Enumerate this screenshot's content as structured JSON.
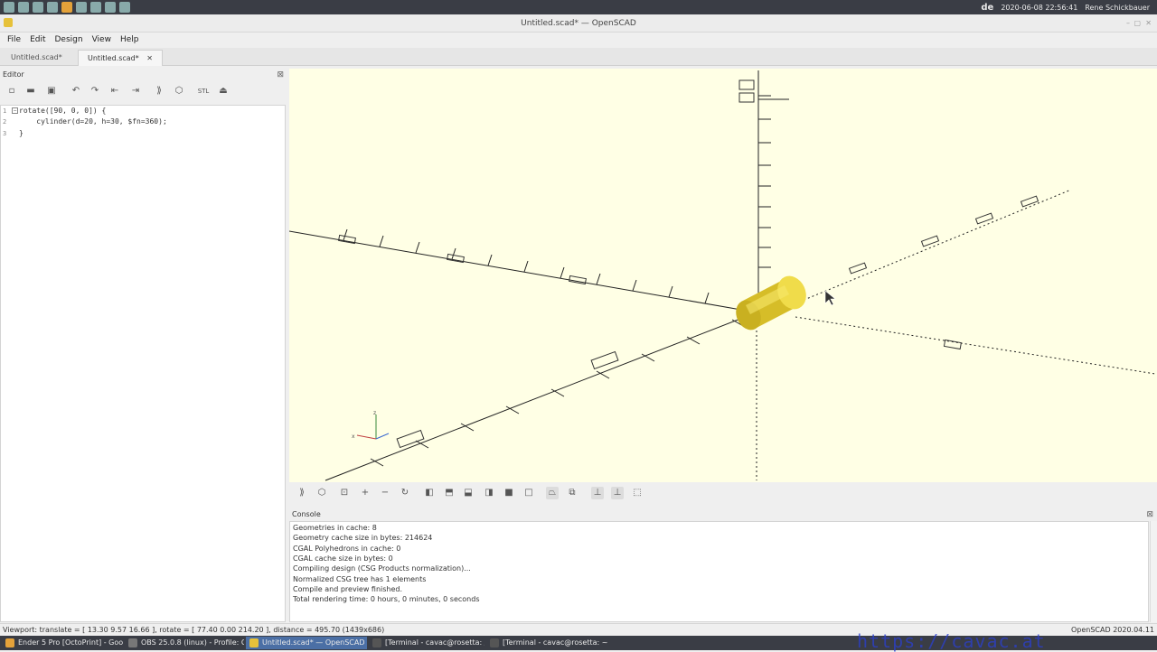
{
  "system_tray": {
    "language": "de",
    "clock": "2020-06-08 22:56:41",
    "user": "Rene Schickbauer"
  },
  "window": {
    "title": "Untitled.scad* — OpenSCAD"
  },
  "menu": {
    "items": [
      "File",
      "Edit",
      "Design",
      "View",
      "Help"
    ]
  },
  "tabs": [
    {
      "label": "Untitled.scad*",
      "active": false
    },
    {
      "label": "Untitled.scad*",
      "active": true,
      "close": "✕"
    }
  ],
  "editor": {
    "title": "Editor",
    "lines": [
      {
        "num": "1",
        "text": "rotate([90, 0, 0]) {"
      },
      {
        "num": "2",
        "text": "    cylinder(d=20, h=30, $fn=360);"
      },
      {
        "num": "3",
        "text": "}"
      }
    ]
  },
  "viewport": {
    "background": "#ffffe5",
    "object_color": "#e6cf3a",
    "axis_color": "#222222"
  },
  "console": {
    "title": "Console",
    "lines": [
      "Geometries in cache: 8",
      "Geometry cache size in bytes: 214624",
      "CGAL Polyhedrons in cache: 0",
      "CGAL cache size in bytes: 0",
      "Compiling design (CSG Products normalization)...",
      "Normalized CSG tree has 1 elements",
      "Compile and preview finished.",
      "Total rendering time: 0 hours, 0 minutes, 0 seconds"
    ]
  },
  "status": {
    "viewport_info": "Viewport: translate = [ 13.30 9.57 16.66 ], rotate = [ 77.40 0.00 214.20 ], distance = 495.70 (1439x686)",
    "version": "OpenSCAD 2020.04.11"
  },
  "taskbar": {
    "items": [
      "Ender 5 Pro [OctoPrint] - Goo...",
      "OBS 25.0.8 (linux) - Profile: G...",
      "Untitled.scad* — OpenSCAD",
      "[Terminal - cavac@rosetta: /...",
      "[Terminal - cavac@rosetta: ~]"
    ]
  },
  "watermark": "https://cavac.at"
}
